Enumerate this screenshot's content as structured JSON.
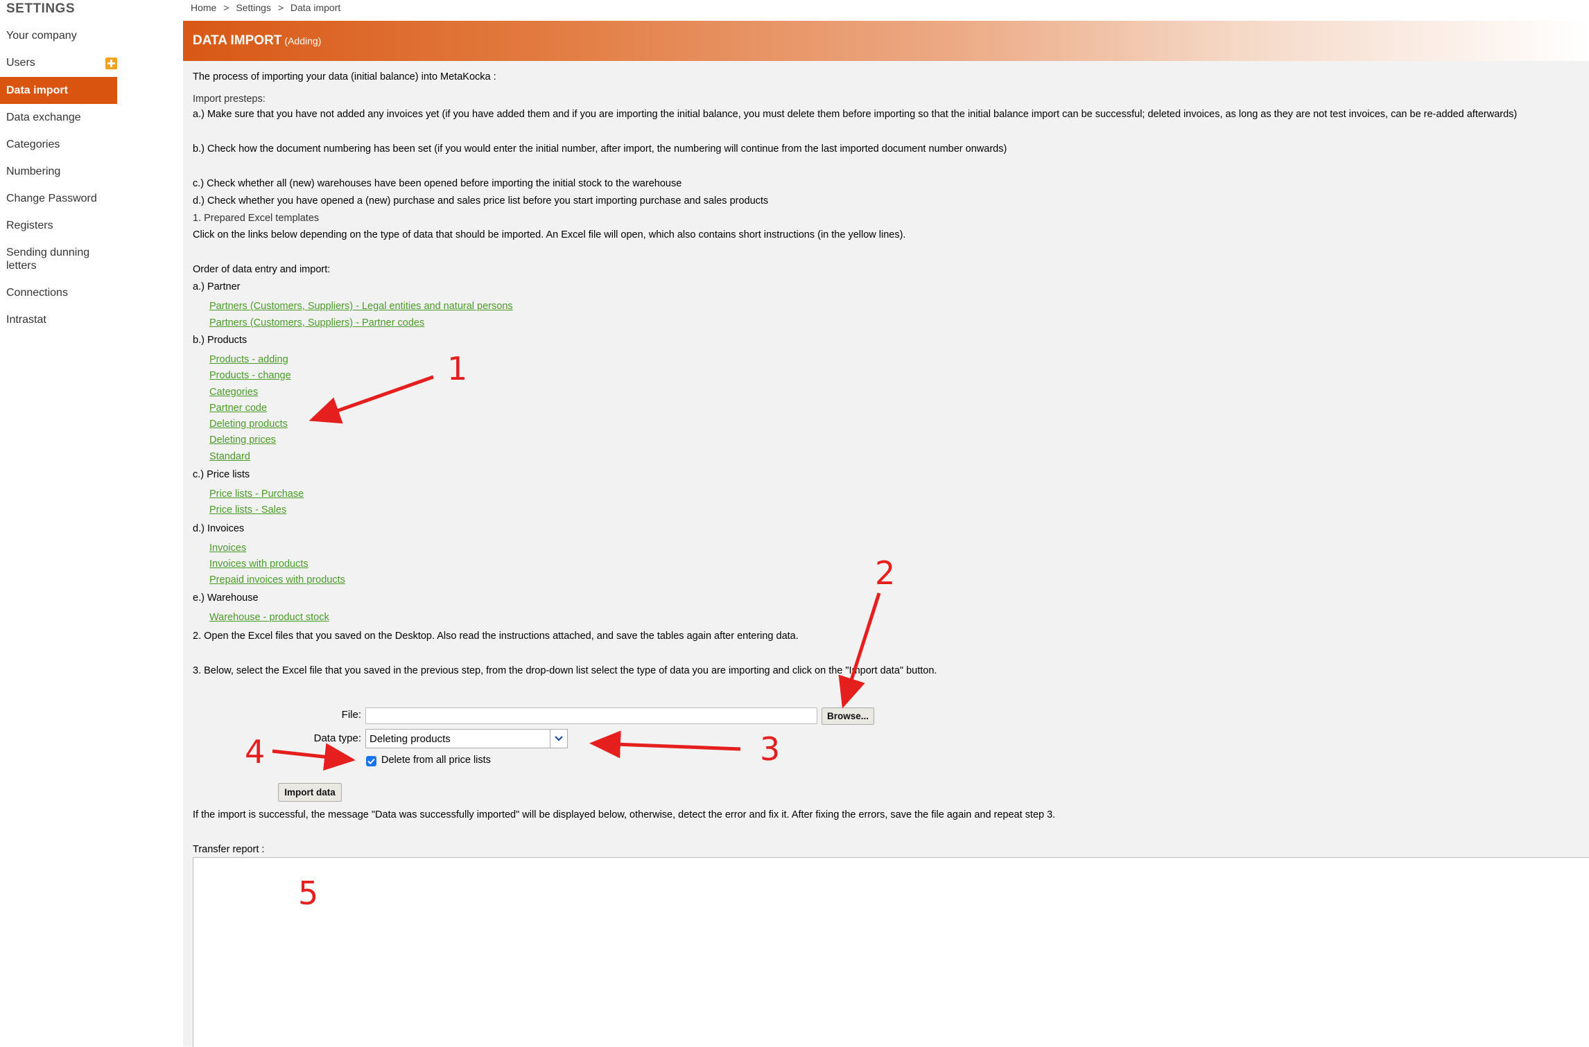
{
  "sidebar": {
    "title": "SETTINGS",
    "items": [
      {
        "label": "Your company"
      },
      {
        "label": "Users"
      },
      {
        "label": "Data import"
      },
      {
        "label": "Data exchange"
      },
      {
        "label": "Categories"
      },
      {
        "label": "Numbering"
      },
      {
        "label": "Change Password"
      },
      {
        "label": "Registers"
      },
      {
        "label": "Sending dunning letters"
      },
      {
        "label": "Connections"
      },
      {
        "label": "Intrastat"
      }
    ]
  },
  "breadcrumb": [
    "Home",
    ">",
    "Settings",
    ">",
    "Data import"
  ],
  "header": {
    "title": "DATA IMPORT",
    "subtitle": "(Adding)"
  },
  "content": {
    "intro": "The process of importing your data (initial balance) into MetaKocka :",
    "presteps_label": "Import presteps:",
    "step_a": "a.) Make sure that you have not added any invoices yet (if you have added them and if you are importing the initial balance, you must delete them before importing so that the initial balance import can be successful; deleted invoices, as long as they are not test invoices, can be re-added afterwards)",
    "step_b": "b.) Check how the document numbering has been set (if you would enter the initial number, after import, the numbering will continue from the last imported document number onwards)",
    "step_c": "c.) Check whether all (new) warehouses have been opened before importing the initial stock to the warehouse",
    "step_d": "d.) Check whether you have opened a (new) purchase and sales price list before you start importing purchase and sales products",
    "prepared_templates": "1. Prepared Excel templates",
    "click_links": "Click on the links below depending on the type of data that should be imported. An Excel file will open, which also contains short instructions (in the yellow lines).",
    "order_label": "Order of data entry and import:",
    "groups": {
      "partner": {
        "label": "a.) Partner",
        "links": [
          "Partners (Customers, Suppliers) - Legal entities and natural persons",
          "Partners (Customers, Suppliers) - Partner codes"
        ]
      },
      "products": {
        "label": "b.) Products",
        "links": [
          "Products - adding",
          "Products - change",
          "Categories",
          "Partner code",
          "Deleting products",
          "Deleting prices",
          "Standard"
        ]
      },
      "pricelists": {
        "label": "c.) Price lists",
        "links": [
          "Price lists - Purchase",
          "Price lists - Sales"
        ]
      },
      "invoices": {
        "label": "d.) Invoices",
        "links": [
          "Invoices",
          "Invoices with products",
          "Prepaid invoices with products"
        ]
      },
      "warehouse": {
        "label": "e.) Warehouse",
        "links": [
          "Warehouse - product stock"
        ]
      }
    },
    "step2": "2. Open the Excel files that you saved on the Desktop. Also read the instructions attached, and save the tables again after entering data.",
    "step3": "3. Below, select the Excel file that you saved in the previous step, from the drop-down list select the type of data you are importing and click on the \"Import data\" button.",
    "success_msg": "If the import is successful, the message \"Data was successfully imported\" will be displayed below, otherwise, detect the error and fix it. After fixing the errors, save the file again and repeat step 3.",
    "report_label": "Transfer report :"
  },
  "form": {
    "file_label": "File:",
    "file_value": "",
    "browse_label": "Browse...",
    "datatype_label": "Data type:",
    "datatype_value": "Deleting products",
    "checkbox_label": "Delete from all price lists",
    "checkbox_checked": true,
    "import_label": "Import data"
  },
  "annotations": [
    "1",
    "2",
    "3",
    "4",
    "5"
  ],
  "colors": {
    "accent": "#d9540e",
    "link": "#4a9a27",
    "annotation": "#e51e1e"
  }
}
